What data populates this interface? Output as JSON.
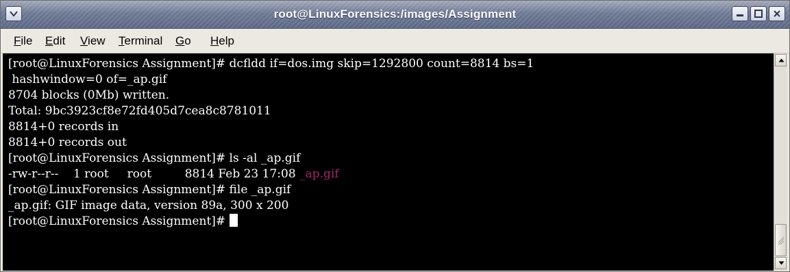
{
  "window": {
    "title": "root@LinuxForensics:/images/Assignment"
  },
  "menu": [
    {
      "accel": "F",
      "rest": "ile"
    },
    {
      "accel": "E",
      "rest": "dit"
    },
    {
      "accel": "V",
      "rest": "iew"
    },
    {
      "accel": "T",
      "rest": "erminal"
    },
    {
      "accel": "G",
      "rest": "o"
    },
    {
      "accel": "H",
      "rest": "elp"
    }
  ],
  "terminal": {
    "lines": [
      "[root@LinuxForensics Assignment]# dcfldd if=dos.img skip=1292800 count=8814 bs=1",
      " hashwindow=0 of=_ap.gif",
      "8704 blocks (0Mb) written.",
      "Total: 9bc3923cf8e72fd405d7cea8c8781011",
      "8814+0 records in",
      "8814+0 records out",
      "[root@LinuxForensics Assignment]# ls -al _ap.gif",
      "-rw-r--r--    1 root     root         8814 Feb 23 17:08 ",
      "[root@LinuxForensics Assignment]# file _ap.gif",
      "_ap.gif: GIF image data, version 89a, 300 x 200",
      "[root@LinuxForensics Assignment]# "
    ],
    "ls_filename": "_ap.gif"
  },
  "colors": {
    "terminal_bg": "#000000",
    "terminal_fg": "#ffffff",
    "gif_filename": "#a3276b"
  },
  "icons": [
    "window-menu-icon",
    "minimize-icon",
    "maximize-icon",
    "close-icon",
    "scroll-up-arrow-icon",
    "scroll-down-arrow-icon",
    "scroll-grip-icon"
  ]
}
